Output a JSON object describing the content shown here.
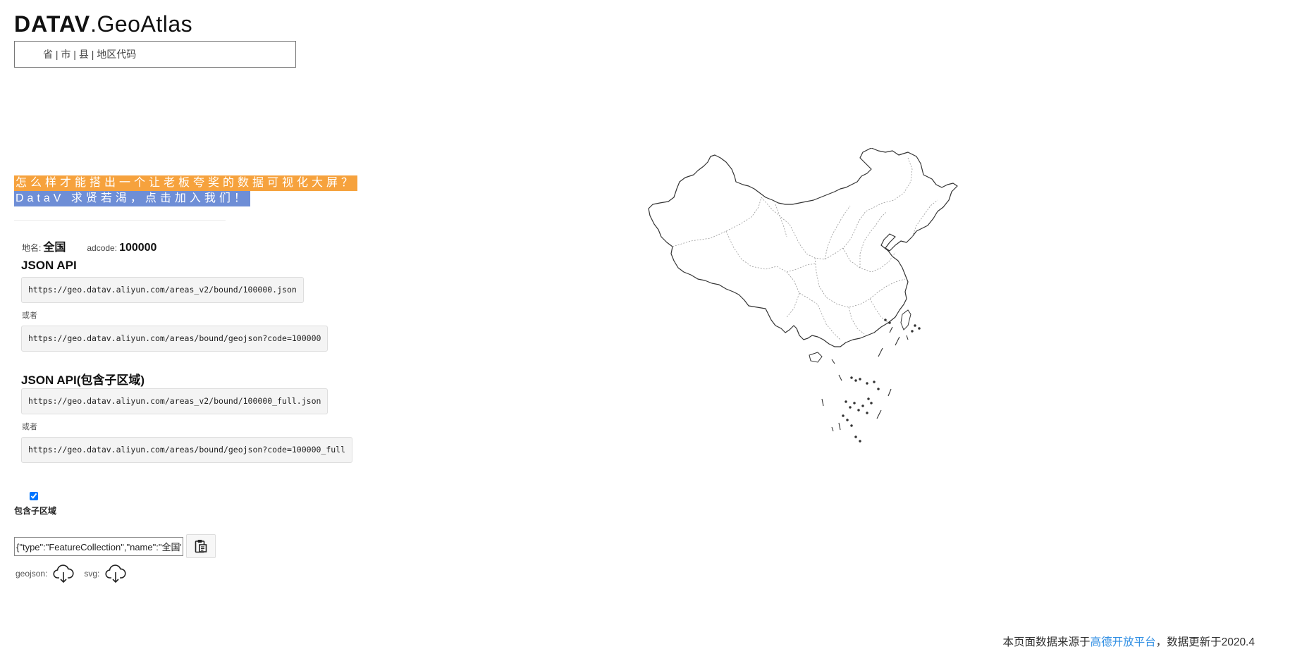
{
  "header": {
    "logo_strong": "DATAV",
    "logo_light": ".GeoAtlas"
  },
  "search": {
    "placeholder": "省 | 市 | 县 | 地区代码"
  },
  "promo": {
    "line1": "怎么样才能搭出一个让老板夸奖的数据可视化大屏？",
    "line2": "DataV 求贤若渴，点击加入我们！",
    "line1_color": "#f6a23d",
    "line2_color": "#6e8ed6"
  },
  "region": {
    "name_label": "地名:",
    "name_value": "全国",
    "adcode_label": "adcode:",
    "adcode_value": "100000"
  },
  "api": {
    "title": "JSON API",
    "url1": "https://geo.datav.aliyun.com/areas_v2/bound/100000.json",
    "or_label": "或者",
    "url2": "https://geo.datav.aliyun.com/areas/bound/geojson?code=100000"
  },
  "api_full": {
    "title": "JSON API(包含子区域)",
    "url1": "https://geo.datav.aliyun.com/areas_v2/bound/100000_full.json",
    "or_label": "或者",
    "url2": "https://geo.datav.aliyun.com/areas/bound/geojson?code=100000_full"
  },
  "options": {
    "include_children_label": "包含子区域",
    "include_children_checked": true
  },
  "output": {
    "json_preview": "{\"type\":\"FeatureCollection\",\"name\":\"全国\""
  },
  "downloads": {
    "geojson_label": "geojson:",
    "svg_label": "svg:",
    "icon": "cloud-download-icon"
  },
  "footer": {
    "prefix": "本页面数据来源于",
    "link_text": "高德开放平台",
    "suffix": "，数据更新于2020.4",
    "link_color": "#2f8ee3"
  }
}
